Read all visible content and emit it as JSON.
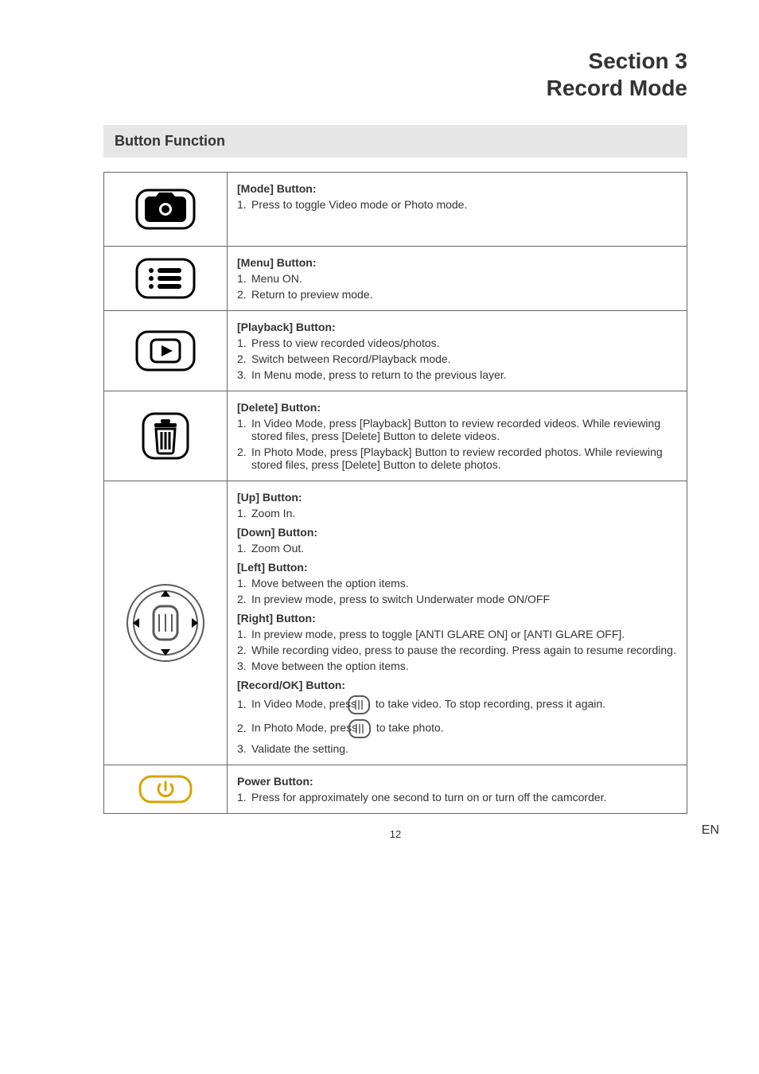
{
  "header": {
    "line1": "Section 3",
    "line2": "Record Mode"
  },
  "section_bar": "Button Function",
  "rows": {
    "mode": {
      "heading": "[Mode] Button:",
      "items": [
        "Press to toggle Video mode or Photo mode."
      ]
    },
    "menu": {
      "heading": "[Menu] Button:",
      "items": [
        "Menu ON.",
        "Return to preview mode."
      ]
    },
    "playback": {
      "heading": "[Playback] Button:",
      "items": [
        "Press to view recorded videos/photos.",
        "Switch between Record/Playback mode.",
        "In Menu mode, press to return to the previous layer."
      ]
    },
    "delete": {
      "heading": "[Delete] Button:",
      "items": [
        "In Video Mode, press [Playback] Button to review recorded videos. While reviewing stored files, press [Delete] Button to delete videos.",
        "In Photo Mode, press [Playback] Button to review recorded photos. While reviewing stored files, press [Delete] Button to delete photos."
      ]
    },
    "dpad": {
      "up_heading": "[Up] Button:",
      "up_items": [
        "Zoom In."
      ],
      "down_heading": "[Down] Button:",
      "down_items": [
        "Zoom Out."
      ],
      "left_heading": "[Left] Button:",
      "left_items": [
        "Move between the option items.",
        "In preview mode, press to switch Underwater mode ON/OFF"
      ],
      "right_heading": "[Right] Button:",
      "right_items": [
        "In preview mode, press to toggle [ANTI GLARE ON] or [ANTI GLARE OFF].",
        "While recording video, press to pause the recording. Press again to resume recording.",
        "Move between the option items."
      ],
      "record_heading": "[Record/OK] Button:",
      "record_item1_a": "In Video Mode, press ",
      "record_item1_b": " to take video. To stop recording, press it again.",
      "record_item2_a": "In Photo Mode, press ",
      "record_item2_b": " to take photo.",
      "record_item3": "Validate the setting."
    },
    "power": {
      "heading": "Power Button:",
      "items": [
        "Press for approximately one second to turn on or turn off the camcorder."
      ]
    }
  },
  "footer": {
    "page": "12",
    "lang": "EN"
  }
}
